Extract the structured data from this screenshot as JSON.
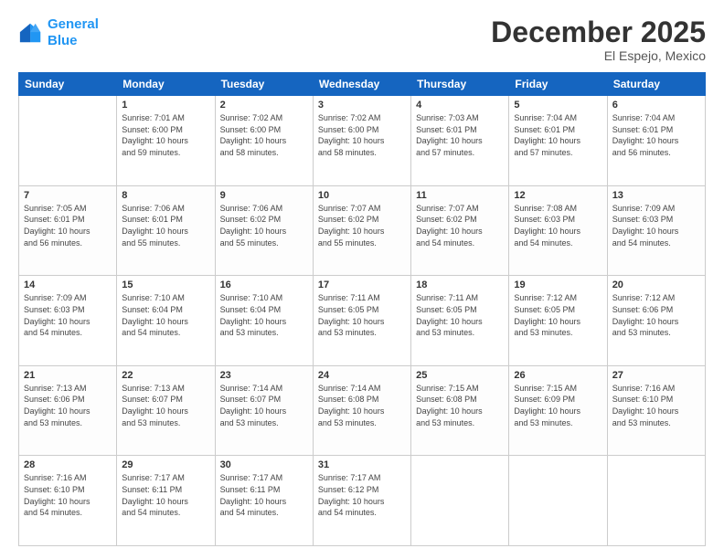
{
  "header": {
    "logo_line1": "General",
    "logo_line2": "Blue",
    "month": "December 2025",
    "location": "El Espejo, Mexico"
  },
  "weekdays": [
    "Sunday",
    "Monday",
    "Tuesday",
    "Wednesday",
    "Thursday",
    "Friday",
    "Saturday"
  ],
  "weeks": [
    [
      {
        "day": "",
        "text": ""
      },
      {
        "day": "1",
        "text": "Sunrise: 7:01 AM\nSunset: 6:00 PM\nDaylight: 10 hours\nand 59 minutes."
      },
      {
        "day": "2",
        "text": "Sunrise: 7:02 AM\nSunset: 6:00 PM\nDaylight: 10 hours\nand 58 minutes."
      },
      {
        "day": "3",
        "text": "Sunrise: 7:02 AM\nSunset: 6:00 PM\nDaylight: 10 hours\nand 58 minutes."
      },
      {
        "day": "4",
        "text": "Sunrise: 7:03 AM\nSunset: 6:01 PM\nDaylight: 10 hours\nand 57 minutes."
      },
      {
        "day": "5",
        "text": "Sunrise: 7:04 AM\nSunset: 6:01 PM\nDaylight: 10 hours\nand 57 minutes."
      },
      {
        "day": "6",
        "text": "Sunrise: 7:04 AM\nSunset: 6:01 PM\nDaylight: 10 hours\nand 56 minutes."
      }
    ],
    [
      {
        "day": "7",
        "text": "Sunrise: 7:05 AM\nSunset: 6:01 PM\nDaylight: 10 hours\nand 56 minutes."
      },
      {
        "day": "8",
        "text": "Sunrise: 7:06 AM\nSunset: 6:01 PM\nDaylight: 10 hours\nand 55 minutes."
      },
      {
        "day": "9",
        "text": "Sunrise: 7:06 AM\nSunset: 6:02 PM\nDaylight: 10 hours\nand 55 minutes."
      },
      {
        "day": "10",
        "text": "Sunrise: 7:07 AM\nSunset: 6:02 PM\nDaylight: 10 hours\nand 55 minutes."
      },
      {
        "day": "11",
        "text": "Sunrise: 7:07 AM\nSunset: 6:02 PM\nDaylight: 10 hours\nand 54 minutes."
      },
      {
        "day": "12",
        "text": "Sunrise: 7:08 AM\nSunset: 6:03 PM\nDaylight: 10 hours\nand 54 minutes."
      },
      {
        "day": "13",
        "text": "Sunrise: 7:09 AM\nSunset: 6:03 PM\nDaylight: 10 hours\nand 54 minutes."
      }
    ],
    [
      {
        "day": "14",
        "text": "Sunrise: 7:09 AM\nSunset: 6:03 PM\nDaylight: 10 hours\nand 54 minutes."
      },
      {
        "day": "15",
        "text": "Sunrise: 7:10 AM\nSunset: 6:04 PM\nDaylight: 10 hours\nand 54 minutes."
      },
      {
        "day": "16",
        "text": "Sunrise: 7:10 AM\nSunset: 6:04 PM\nDaylight: 10 hours\nand 53 minutes."
      },
      {
        "day": "17",
        "text": "Sunrise: 7:11 AM\nSunset: 6:05 PM\nDaylight: 10 hours\nand 53 minutes."
      },
      {
        "day": "18",
        "text": "Sunrise: 7:11 AM\nSunset: 6:05 PM\nDaylight: 10 hours\nand 53 minutes."
      },
      {
        "day": "19",
        "text": "Sunrise: 7:12 AM\nSunset: 6:05 PM\nDaylight: 10 hours\nand 53 minutes."
      },
      {
        "day": "20",
        "text": "Sunrise: 7:12 AM\nSunset: 6:06 PM\nDaylight: 10 hours\nand 53 minutes."
      }
    ],
    [
      {
        "day": "21",
        "text": "Sunrise: 7:13 AM\nSunset: 6:06 PM\nDaylight: 10 hours\nand 53 minutes."
      },
      {
        "day": "22",
        "text": "Sunrise: 7:13 AM\nSunset: 6:07 PM\nDaylight: 10 hours\nand 53 minutes."
      },
      {
        "day": "23",
        "text": "Sunrise: 7:14 AM\nSunset: 6:07 PM\nDaylight: 10 hours\nand 53 minutes."
      },
      {
        "day": "24",
        "text": "Sunrise: 7:14 AM\nSunset: 6:08 PM\nDaylight: 10 hours\nand 53 minutes."
      },
      {
        "day": "25",
        "text": "Sunrise: 7:15 AM\nSunset: 6:08 PM\nDaylight: 10 hours\nand 53 minutes."
      },
      {
        "day": "26",
        "text": "Sunrise: 7:15 AM\nSunset: 6:09 PM\nDaylight: 10 hours\nand 53 minutes."
      },
      {
        "day": "27",
        "text": "Sunrise: 7:16 AM\nSunset: 6:10 PM\nDaylight: 10 hours\nand 53 minutes."
      }
    ],
    [
      {
        "day": "28",
        "text": "Sunrise: 7:16 AM\nSunset: 6:10 PM\nDaylight: 10 hours\nand 54 minutes."
      },
      {
        "day": "29",
        "text": "Sunrise: 7:17 AM\nSunset: 6:11 PM\nDaylight: 10 hours\nand 54 minutes."
      },
      {
        "day": "30",
        "text": "Sunrise: 7:17 AM\nSunset: 6:11 PM\nDaylight: 10 hours\nand 54 minutes."
      },
      {
        "day": "31",
        "text": "Sunrise: 7:17 AM\nSunset: 6:12 PM\nDaylight: 10 hours\nand 54 minutes."
      },
      {
        "day": "",
        "text": ""
      },
      {
        "day": "",
        "text": ""
      },
      {
        "day": "",
        "text": ""
      }
    ]
  ]
}
